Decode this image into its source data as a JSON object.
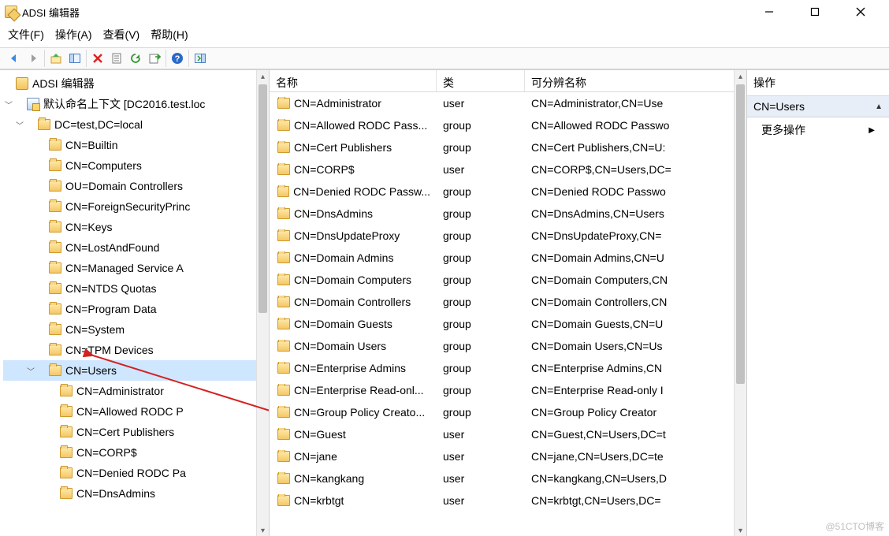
{
  "title": "ADSI 编辑器",
  "menu": {
    "file": "文件(F)",
    "action": "操作(A)",
    "view": "查看(V)",
    "help": "帮助(H)"
  },
  "tree": {
    "root_label": "ADSI 编辑器",
    "context_label": "默认命名上下文 [DC2016.test.loc",
    "dc_label": "DC=test,DC=local",
    "nodes": [
      "CN=Builtin",
      "CN=Computers",
      "OU=Domain Controllers",
      "CN=ForeignSecurityPrinc",
      "CN=Keys",
      "CN=LostAndFound",
      "CN=Managed Service A",
      "CN=NTDS Quotas",
      "CN=Program Data",
      "CN=System",
      "CN=TPM Devices"
    ],
    "selected_label": "CN=Users",
    "users_children": [
      "CN=Administrator",
      "CN=Allowed RODC P",
      "CN=Cert Publishers",
      "CN=CORP$",
      "CN=Denied RODC Pa",
      "CN=DnsAdmins"
    ]
  },
  "list": {
    "columns": {
      "name": "名称",
      "class": "类",
      "dn": "可分辨名称"
    },
    "rows": [
      {
        "name": "CN=Administrator",
        "class": "user",
        "dn": "CN=Administrator,CN=Use"
      },
      {
        "name": "CN=Allowed RODC Pass...",
        "class": "group",
        "dn": "CN=Allowed RODC Passwo"
      },
      {
        "name": "CN=Cert Publishers",
        "class": "group",
        "dn": "CN=Cert Publishers,CN=U:"
      },
      {
        "name": "CN=CORP$",
        "class": "user",
        "dn": "CN=CORP$,CN=Users,DC="
      },
      {
        "name": "CN=Denied RODC Passw...",
        "class": "group",
        "dn": "CN=Denied RODC Passwo"
      },
      {
        "name": "CN=DnsAdmins",
        "class": "group",
        "dn": "CN=DnsAdmins,CN=Users"
      },
      {
        "name": "CN=DnsUpdateProxy",
        "class": "group",
        "dn": "CN=DnsUpdateProxy,CN="
      },
      {
        "name": "CN=Domain Admins",
        "class": "group",
        "dn": "CN=Domain Admins,CN=U"
      },
      {
        "name": "CN=Domain Computers",
        "class": "group",
        "dn": "CN=Domain Computers,CN"
      },
      {
        "name": "CN=Domain Controllers",
        "class": "group",
        "dn": "CN=Domain Controllers,CN"
      },
      {
        "name": "CN=Domain Guests",
        "class": "group",
        "dn": "CN=Domain Guests,CN=U"
      },
      {
        "name": "CN=Domain Users",
        "class": "group",
        "dn": "CN=Domain Users,CN=Us"
      },
      {
        "name": "CN=Enterprise Admins",
        "class": "group",
        "dn": "CN=Enterprise Admins,CN"
      },
      {
        "name": "CN=Enterprise Read-onl...",
        "class": "group",
        "dn": "CN=Enterprise Read-only I"
      },
      {
        "name": "CN=Group Policy Creato...",
        "class": "group",
        "dn": "CN=Group Policy Creator"
      },
      {
        "name": "CN=Guest",
        "class": "user",
        "dn": "CN=Guest,CN=Users,DC=t"
      },
      {
        "name": "CN=jane",
        "class": "user",
        "dn": "CN=jane,CN=Users,DC=te"
      },
      {
        "name": "CN=kangkang",
        "class": "user",
        "dn": "CN=kangkang,CN=Users,D"
      },
      {
        "name": "CN=krbtgt",
        "class": "user",
        "dn": "CN=krbtgt,CN=Users,DC="
      }
    ]
  },
  "actions": {
    "header": "操作",
    "group_title": "CN=Users",
    "more": "更多操作"
  },
  "watermark": "@51CTO博客"
}
